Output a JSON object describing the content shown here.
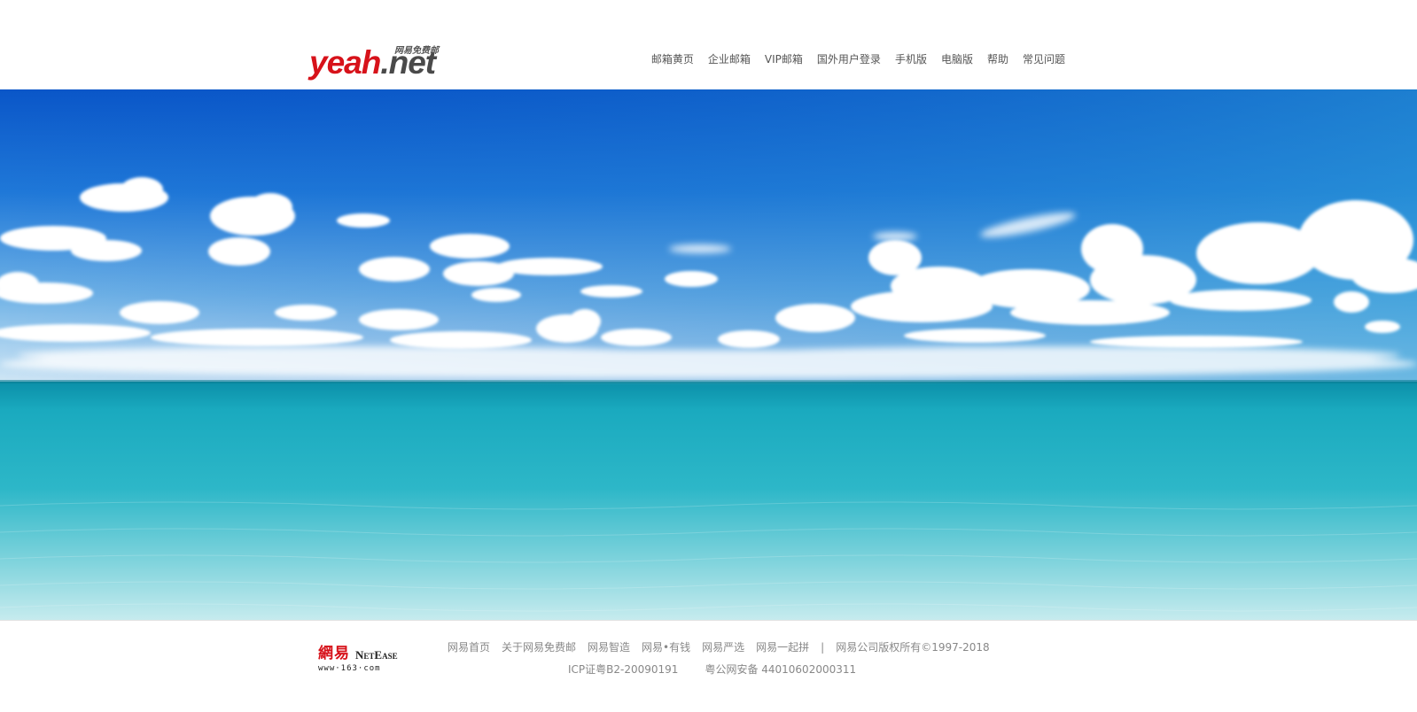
{
  "header": {
    "logo": {
      "main": "yeah",
      "domain": ".net",
      "tagline": "网易免费邮"
    },
    "nav": [
      {
        "name": "nav-mail-yellow-pages",
        "label": "邮箱黄页"
      },
      {
        "name": "nav-enterprise-mail",
        "label": "企业邮箱"
      },
      {
        "name": "nav-vip-mail",
        "label": "VIP邮箱"
      },
      {
        "name": "nav-overseas-login",
        "label": "国外用户登录"
      },
      {
        "name": "nav-mobile",
        "label": "手机版"
      },
      {
        "name": "nav-desktop",
        "label": "电脑版"
      },
      {
        "name": "nav-help",
        "label": "帮助"
      },
      {
        "name": "nav-faq",
        "label": "常见问题"
      }
    ]
  },
  "banner": {
    "scene": "sky-and-ocean",
    "colors": {
      "sky_top": "#0a56c8",
      "sky_horizon": "#cfe6f5",
      "sea_far": "#0f9fb5",
      "sea_near": "#b9e6ea"
    }
  },
  "footer": {
    "netease_logo": {
      "cn": "網易",
      "en": "NetEase",
      "url": "www·163·com"
    },
    "links": [
      {
        "name": "footer-link-netease-home",
        "label": "网易首页"
      },
      {
        "name": "footer-link-about",
        "label": "关于网易免费邮"
      },
      {
        "name": "footer-link-zhizao",
        "label": "网易智造"
      },
      {
        "name": "footer-link-youqian",
        "label": "网易•有钱"
      },
      {
        "name": "footer-link-yanxuan",
        "label": "网易严选"
      },
      {
        "name": "footer-link-yiqipin",
        "label": "网易一起拼"
      }
    ],
    "separator": "|",
    "copyright": "网易公司版权所有©1997-2018",
    "icp": "ICP证粤B2-20090191",
    "police": "粤公网安备 44010602000311"
  },
  "colors": {
    "brand_red": "#d7121a",
    "nav_text": "#555555",
    "footer_text": "#888888"
  }
}
